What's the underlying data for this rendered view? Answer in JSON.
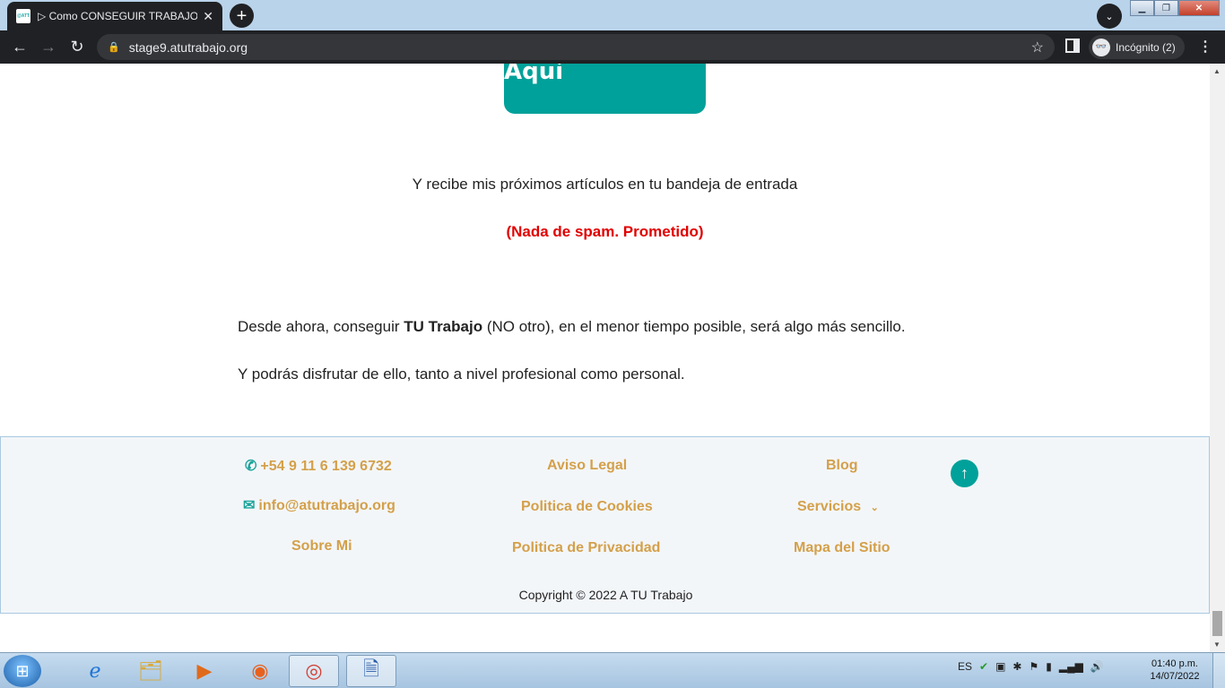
{
  "browser": {
    "tab_title": "▷ Como CONSEGUIR TRABAJO |",
    "favicon_text": "@ATT",
    "url": "stage9.atutrabajo.org",
    "incognito_label": "Incógnito (2)"
  },
  "page": {
    "cta_label": "Registrate Aquí",
    "subscribe_text": "Y recibe mis próximos artículos en tu bandeja de entrada",
    "no_spam": "(Nada de spam. Prometido)",
    "para1_pre": "Desde ahora, conseguir ",
    "para1_bold": "TU Trabajo",
    "para1_post": " (NO otro), en el menor tiempo posible, será algo más sencillo.",
    "para2": "Y podrás disfrutar de ello, tanto a nivel profesional como personal."
  },
  "footer": {
    "phone": "+54 9 11 6 139 6732",
    "email": "info@atutrabajo.org",
    "about": "Sobre Mi",
    "legal": "Aviso Legal",
    "cookies": "Politica de Cookies",
    "privacy": "Politica de Privacidad",
    "blog": "Blog",
    "services": "Servicios",
    "sitemap": "Mapa del Sitio",
    "copyright": "Copyright © 2022 A TU Trabajo"
  },
  "taskbar": {
    "lang": "ES",
    "time": "01:40 p.m.",
    "date": "14/07/2022"
  },
  "colors": {
    "accent": "#00a19a",
    "link": "#d4a04a",
    "alert": "#e10000"
  }
}
